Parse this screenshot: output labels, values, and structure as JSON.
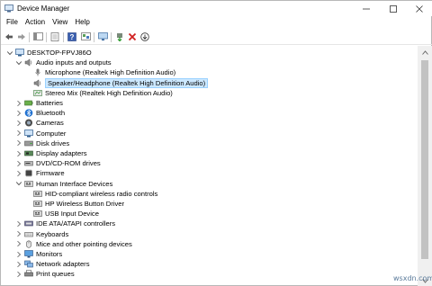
{
  "window": {
    "title": "Device Manager"
  },
  "menu": [
    "File",
    "Action",
    "View",
    "Help"
  ],
  "toolbar": [
    "back-icon",
    "forward-icon",
    "show-hide-tree-icon",
    "properties-icon",
    "help-icon",
    "show-hidden-icon",
    "scan-hardware-icon",
    "update-driver-icon",
    "uninstall-icon",
    "download-icon"
  ],
  "tree": {
    "root": "DESKTOP-FPVJ86O",
    "items": [
      {
        "label": "Audio inputs and outputs",
        "icon": "audio-icon",
        "expanded": true
      },
      {
        "label": "Microphone (Realtek High Definition Audio)",
        "icon": "microphone-icon",
        "child": true
      },
      {
        "label": "Speaker/Headphone (Realtek High Definition Audio)",
        "icon": "speaker-icon",
        "child": true,
        "selected": true
      },
      {
        "label": "Stereo Mix (Realtek High Definition Audio)",
        "icon": "stereo-mix-icon",
        "child": true
      },
      {
        "label": "Batteries",
        "icon": "battery-icon"
      },
      {
        "label": "Bluetooth",
        "icon": "bluetooth-icon"
      },
      {
        "label": "Cameras",
        "icon": "camera-icon"
      },
      {
        "label": "Computer",
        "icon": "computer-icon"
      },
      {
        "label": "Disk drives",
        "icon": "disk-drive-icon"
      },
      {
        "label": "Display adapters",
        "icon": "display-adapter-icon"
      },
      {
        "label": "DVD/CD-ROM drives",
        "icon": "dvd-icon"
      },
      {
        "label": "Firmware",
        "icon": "firmware-icon"
      },
      {
        "label": "Human Interface Devices",
        "icon": "hid-icon",
        "expanded": true
      },
      {
        "label": "HID-compliant wireless radio controls",
        "icon": "hid-device-icon",
        "child": true
      },
      {
        "label": "HP Wireless Button Driver",
        "icon": "hid-device-icon",
        "child": true
      },
      {
        "label": "USB Input Device",
        "icon": "hid-device-icon",
        "child": true
      },
      {
        "label": "IDE ATA/ATAPI controllers",
        "icon": "ide-controller-icon"
      },
      {
        "label": "Keyboards",
        "icon": "keyboard-icon"
      },
      {
        "label": "Mice and other pointing devices",
        "icon": "mouse-icon"
      },
      {
        "label": "Monitors",
        "icon": "monitor-icon"
      },
      {
        "label": "Network adapters",
        "icon": "network-adapter-icon"
      },
      {
        "label": "Print queues",
        "icon": "printer-icon"
      }
    ]
  },
  "watermark": "wsxdn.com"
}
